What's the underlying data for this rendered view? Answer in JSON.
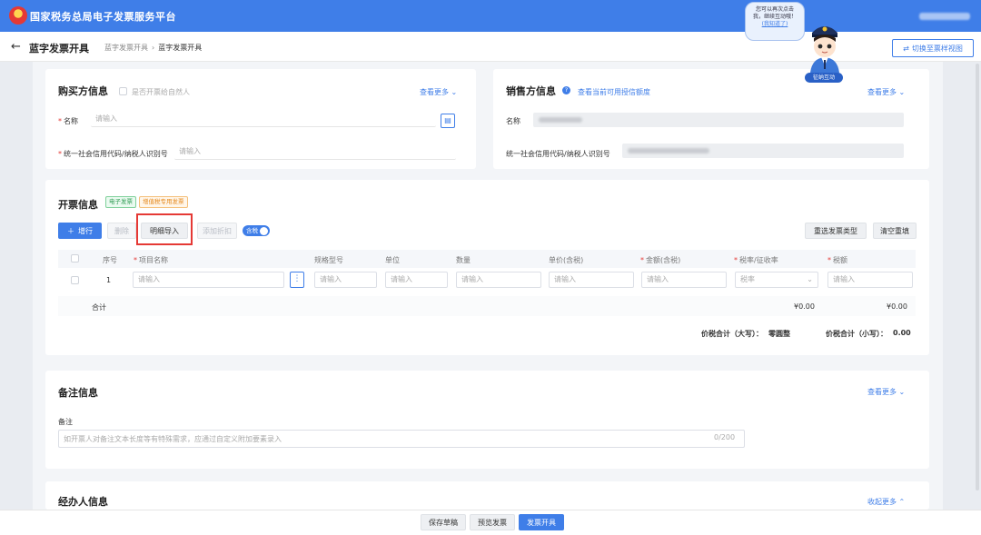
{
  "app": {
    "title": "国家税务总局电子发票服务平台"
  },
  "header": {
    "page_title": "蓝字发票开具",
    "breadcrumb": [
      "蓝字发票开具",
      "蓝字发票开具"
    ],
    "switch_view": "切换至票样视图"
  },
  "mascot": {
    "bubble_line1": "您可以再次点击",
    "bubble_line2": "我，继续互动哦！",
    "bubble_link": "(我知道了)",
    "label": "征纳互动"
  },
  "buyer": {
    "title": "购买方信息",
    "natural_person": "是否开票给自然人",
    "more": "查看更多",
    "name_label": "名称",
    "name_placeholder": "请输入",
    "tax_id_label": "统一社会信用代码/纳税人识别号",
    "tax_id_placeholder": "请输入"
  },
  "seller": {
    "title": "销售方信息",
    "credit_link": "查看当前可用授信额度",
    "more": "查看更多",
    "name_label": "名称",
    "tax_id_label": "统一社会信用代码/纳税人识别号"
  },
  "invoice": {
    "title": "开票信息",
    "tag_electronic": "电子发票",
    "tag_special": "增值税专用发票",
    "add_row": "增行",
    "delete": "删除",
    "import_detail": "明细导入",
    "add_discount": "添加折扣",
    "tax_included": "含税",
    "reselect_type": "重选发票类型",
    "clear": "清空重填",
    "columns": [
      "序号",
      "项目名称",
      "规格型号",
      "单位",
      "数量",
      "单价(含税)",
      "金额(含税)",
      "税率/征收率",
      "税额"
    ],
    "row": {
      "index": "1",
      "placeholder": "请输入",
      "rate_placeholder": "税率"
    },
    "total_label": "合计",
    "total_amount": "¥0.00",
    "total_tax": "¥0.00",
    "upper_total_label": "价税合计（大写）：",
    "upper_total_value": "零圆整",
    "lower_total_label": "价税合计（小写）：",
    "lower_total_value": "0.00"
  },
  "remark": {
    "title": "备注信息",
    "more": "查看更多",
    "label": "备注",
    "placeholder": "如开票人对备注文本长度等有特殊需求，应通过自定义附加要素录入",
    "counter": "0/200"
  },
  "handler": {
    "title": "经办人信息",
    "collapse": "收起更多"
  },
  "footer": {
    "save_draft": "保存草稿",
    "preview": "预览发票",
    "issue": "发票开具"
  }
}
